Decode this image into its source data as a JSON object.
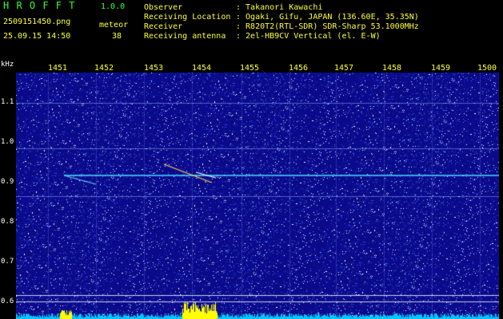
{
  "app": {
    "title_letters": "H R O F F T",
    "version": "1.0.0"
  },
  "file": {
    "name": "2509151450.png",
    "datetime": "25.09.15 14:50"
  },
  "meteor": {
    "label": "meteor",
    "count": "38"
  },
  "info": [
    {
      "key": "Observer",
      "value": ": Takanori Kawachi"
    },
    {
      "key": "Receiving Location",
      "value": ": Ogaki, Gifu, JAPAN (136.60E, 35.35N)"
    },
    {
      "key": "Receiver",
      "value": ": R820T2(RTL-SDR) SDR-Sharp 53.1000MHz"
    },
    {
      "key": "Receiving antenna",
      "value": ": 2el-HB9CV Vertical (el. E-W)"
    }
  ],
  "axis": {
    "y_unit": "kHz",
    "y_ticks": [
      "1.1",
      "1.0",
      "0.9",
      "0.8",
      "0.7",
      "0.6"
    ],
    "x_ticks": [
      "1451",
      "1452",
      "1453",
      "1454",
      "1455",
      "1456",
      "1457",
      "1458",
      "1459",
      "1500"
    ]
  },
  "colors": {
    "background": "#0a0a8a",
    "noise_low": "#0b0b9a",
    "noise_high": "#ffffff",
    "carrier": "#40e0ff",
    "graph_cyan": "#00c8ff",
    "graph_yellow": "#ffff00",
    "header_green": "#33ff33",
    "header_yellow": "#ffff33"
  }
}
